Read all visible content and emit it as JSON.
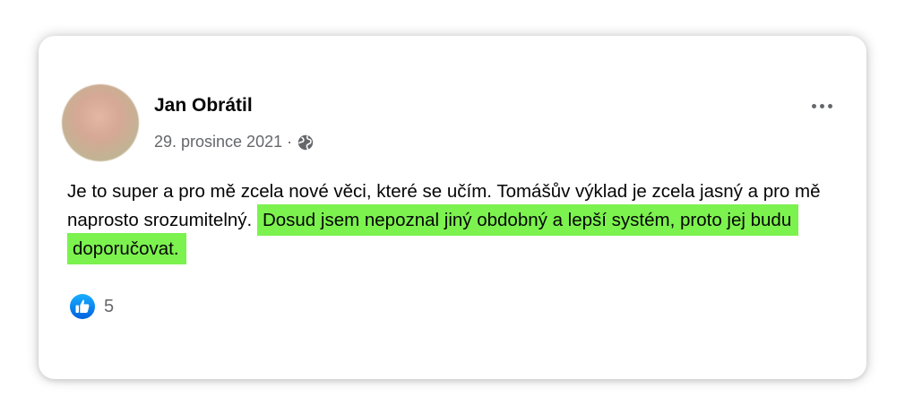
{
  "post": {
    "author": "Jan Obrátil",
    "date": "29. prosince 2021",
    "separator": "·",
    "privacy_icon": "globe-icon",
    "more_icon": "more-dots-icon",
    "text_plain": "Je to super a pro mě zcela nové věci, které se učím. Tomášův výklad je zcela jasný a pro mě naprosto srozumitelný.",
    "text_highlighted": "Dosud jsem nepoznal jiný obdobný a lepší systém, proto jej budu doporučovat.",
    "highlight_color": "#7cf24f",
    "reaction_icon": "like-icon",
    "reaction_count": "5"
  }
}
